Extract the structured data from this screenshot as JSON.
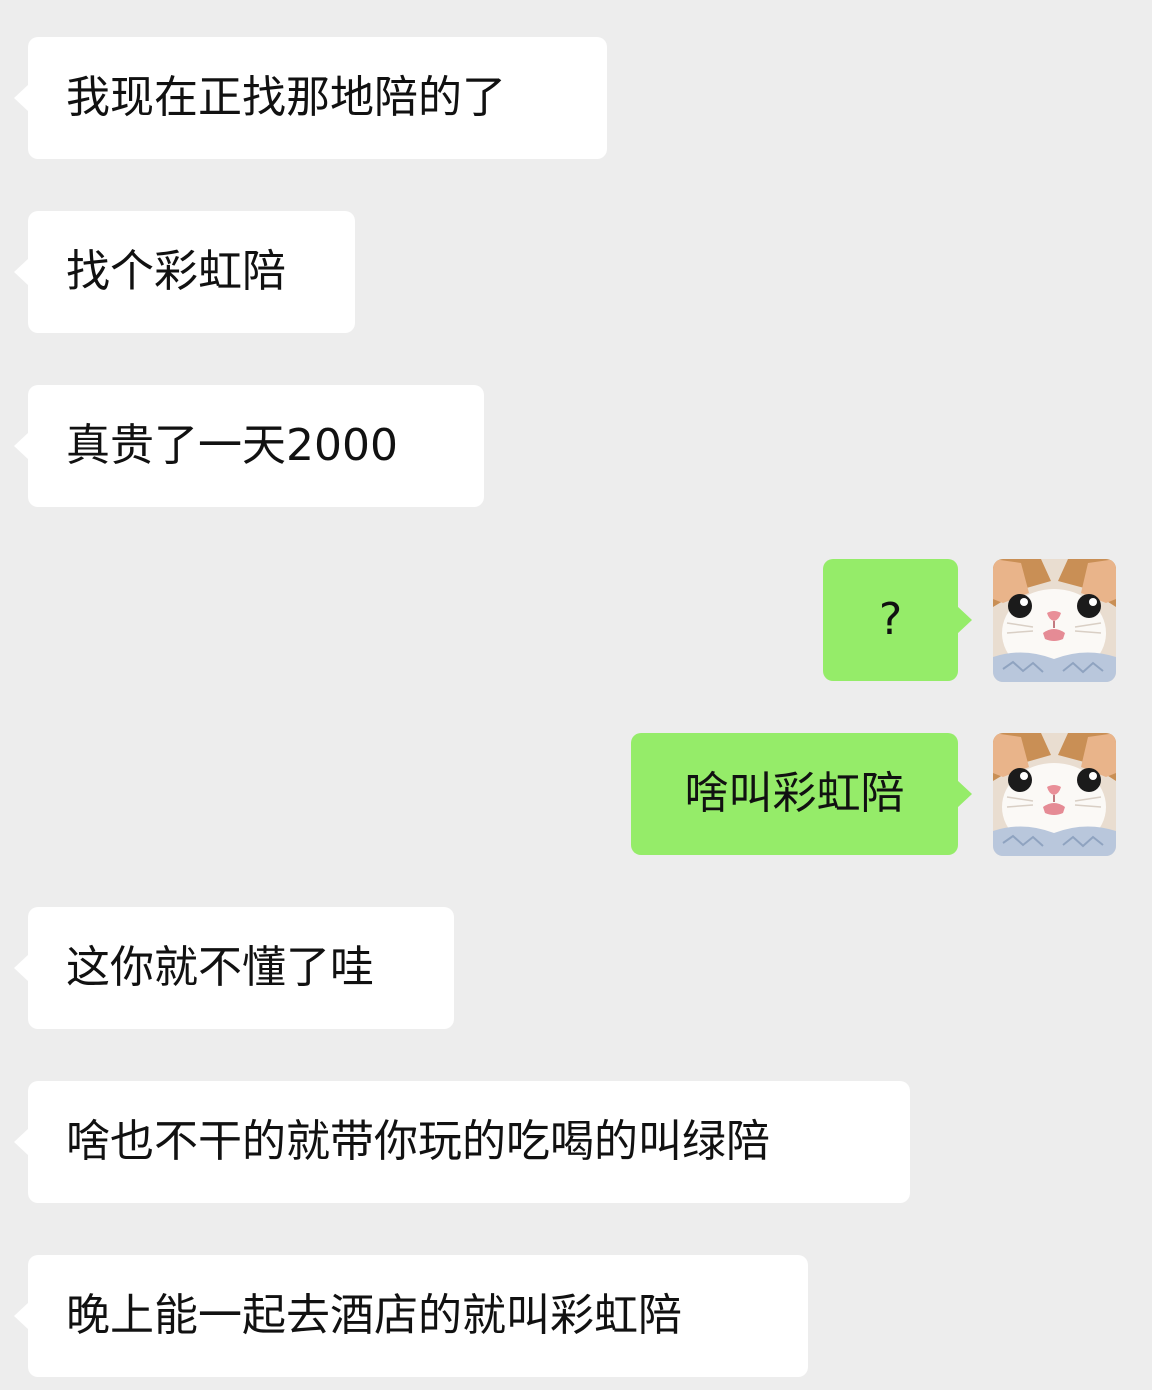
{
  "chat": {
    "messages": [
      {
        "side": "incoming",
        "text": "我现在正找那地陪的了"
      },
      {
        "side": "incoming",
        "text": "找个彩虹陪"
      },
      {
        "side": "incoming",
        "text": "真贵了一天2000"
      },
      {
        "side": "outgoing",
        "text": "?",
        "avatar": "cat-avatar-icon"
      },
      {
        "side": "outgoing",
        "text": "啥叫彩虹陪",
        "avatar": "cat-avatar-icon"
      },
      {
        "side": "incoming",
        "text": "这你就不懂了哇"
      },
      {
        "side": "incoming",
        "text": "啥也不干的就带你玩的吃喝的叫绿陪"
      },
      {
        "side": "incoming",
        "text": "晚上能一起去酒店的就叫彩虹陪"
      }
    ]
  },
  "colors": {
    "background": "#ededed",
    "incoming_bubble": "#ffffff",
    "outgoing_bubble": "#95ec69",
    "text": "#111111"
  }
}
